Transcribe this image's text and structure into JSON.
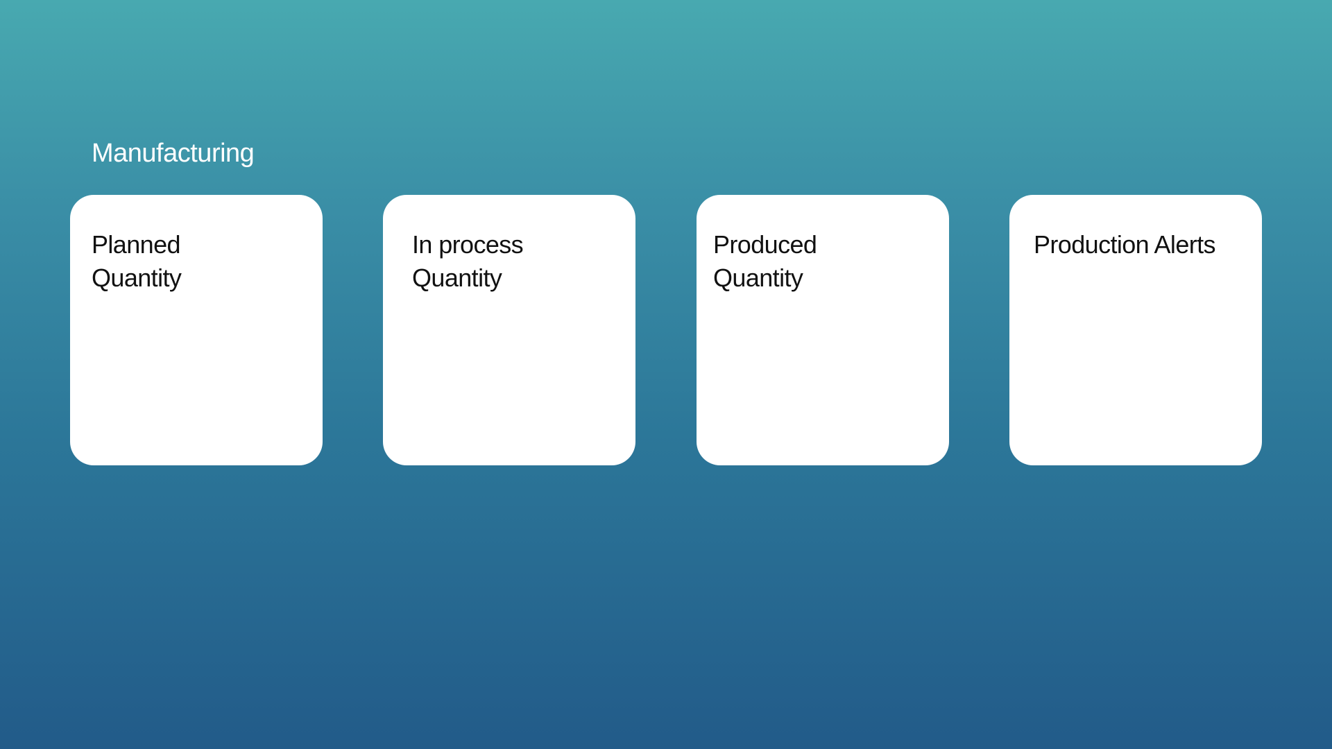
{
  "section": {
    "title": "Manufacturing"
  },
  "cards": [
    {
      "lines": [
        "Planned",
        "Quantity"
      ]
    },
    {
      "lines": [
        "In process",
        "Quantity"
      ]
    },
    {
      "lines": [
        "Produced",
        "Quantity"
      ]
    },
    {
      "lines": [
        "Production Alerts"
      ]
    }
  ],
  "colors": {
    "background_top": "#48a9b0",
    "background_bottom": "#225b89",
    "card_background": "#ffffff",
    "card_text": "#111111",
    "title_text": "#ffffff"
  }
}
